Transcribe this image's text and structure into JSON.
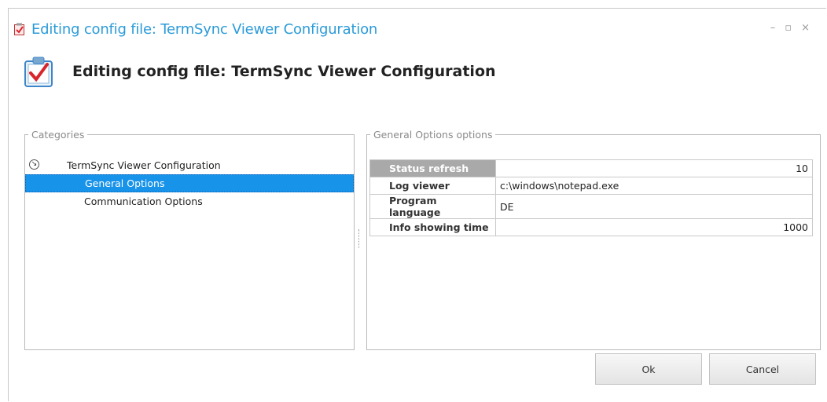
{
  "window": {
    "title": "Editing config file: TermSync Viewer Configuration",
    "controls": {
      "minimize": "–",
      "maximize": "▫",
      "close": "×"
    }
  },
  "header": {
    "title": "Editing config file: TermSync Viewer Configuration",
    "icon": "checklist-icon"
  },
  "categories": {
    "legend": "Categories",
    "root": {
      "label": "TermSync Viewer Configuration",
      "expander": "↘"
    },
    "children": [
      {
        "label": "General Options",
        "selected": true
      },
      {
        "label": "Communication Options",
        "selected": false
      }
    ]
  },
  "options": {
    "legend": "General Options options",
    "rows": [
      {
        "name": "Status refresh",
        "value": "10",
        "selected": true
      },
      {
        "name": "Log viewer",
        "value": "c:\\windows\\notepad.exe",
        "selected": false
      },
      {
        "name": "Program language",
        "value": "DE",
        "selected": false
      },
      {
        "name": "Info showing time",
        "value": "1000",
        "selected": false
      }
    ]
  },
  "buttons": {
    "ok": "Ok",
    "cancel": "Cancel"
  },
  "colors": {
    "title_blue": "#2b9bd8",
    "selection_blue": "#1893ea",
    "selected_prop_bg": "#a9a9a9",
    "icon_red": "#d8242b"
  }
}
